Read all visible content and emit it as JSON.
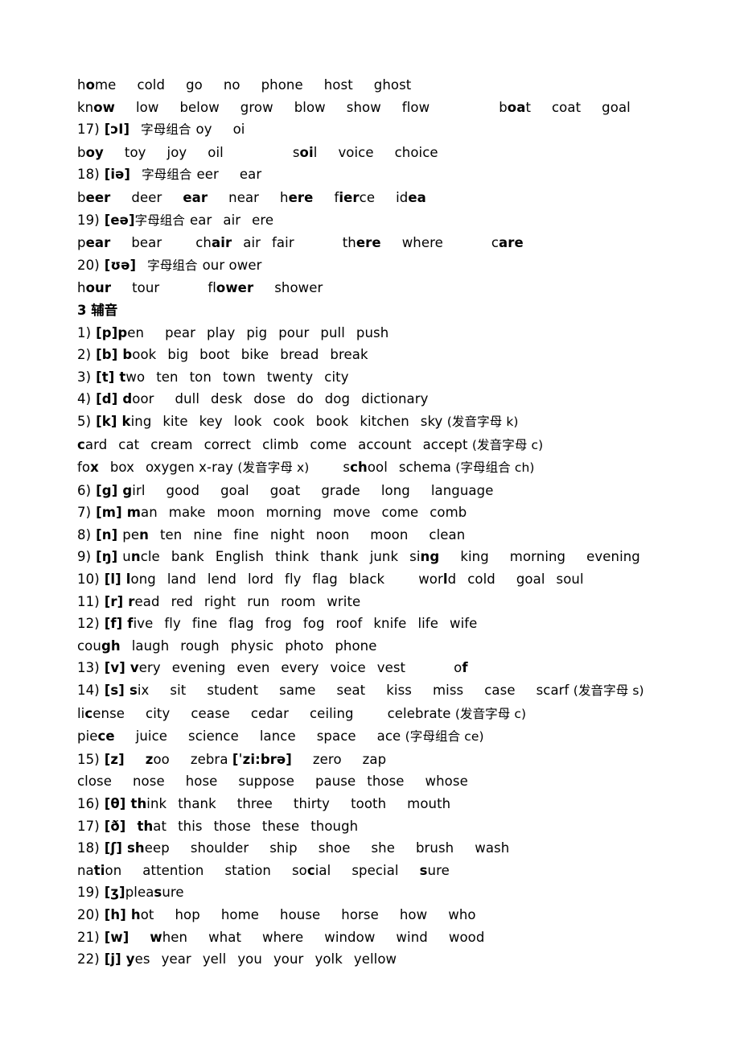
{
  "document": {
    "title_section": "3 辅音",
    "page_language": "zh-CN/en",
    "vowel_lines": [
      {
        "id": "vowel-words-ou-1",
        "words": "home   cold   go   no   phone   host   ghost",
        "text": "home cold go no phone host ghost"
      },
      {
        "id": "vowel-words-ou-2",
        "text": "know low below grow blow show flow boat coat goal"
      },
      {
        "id": "entry-17-header",
        "number": "17)",
        "ipa": "[ɔI]",
        "note": "字母组合",
        "combos": "oy    oi"
      },
      {
        "id": "entry-17-words",
        "text": "boy toy joy oil soil voice choice"
      },
      {
        "id": "entry-18-header",
        "number": "18)",
        "ipa": "[iə]",
        "note": "字母组合",
        "combos": "eer    ear"
      },
      {
        "id": "entry-18-words",
        "text": "beer deer ear near here fierce idea"
      },
      {
        "id": "entry-19-header",
        "number": "19)",
        "ipa": "[eə]",
        "note": "字母组合",
        "combos": "ear  air  ere"
      },
      {
        "id": "entry-19-words",
        "text": "pear bear chair air fair there where care"
      },
      {
        "id": "entry-20-header",
        "number": "20)",
        "ipa": "[ʊə]",
        "note": "字母组合",
        "combos": "our ower"
      },
      {
        "id": "entry-20-words",
        "text": "hour tour flower shower"
      }
    ],
    "section_heading": "3 辅音",
    "consonant_entries": [
      {
        "number": "1)",
        "ipa": "[p]",
        "words": "pen   pear   play   pig   pour   pull   push"
      },
      {
        "number": "2)",
        "ipa": "[b]",
        "words": "book  big  boot  bike  bread  break"
      },
      {
        "number": "3)",
        "ipa": "[t]",
        "words": "two  ten  ton  town  twenty   city"
      },
      {
        "number": "4)",
        "ipa": "[d]",
        "words": "door   dull   desk  dose  do  dog   dictionary"
      },
      {
        "number": "5)",
        "ipa": "[k]",
        "words": "king  kite  key  look  cook  book  kitchen  sky (发音字母 k)"
      },
      {
        "number": "6)",
        "ipa": "[g]",
        "words": "girl   good   goal   goat   grade   long   language"
      },
      {
        "number": "7)",
        "ipa": "[m]",
        "words": "man  make  moon  morning  move  come  comb"
      },
      {
        "number": "8)",
        "ipa": "[n]",
        "words": "pen  ten  nine  fine  night  noon   moon   clean"
      },
      {
        "number": "9)",
        "ipa": "[ŋ]",
        "words": "uncle  bank  English  think  thank  junk  sing   king   morning   evening"
      },
      {
        "number": "10)",
        "ipa": "[l]",
        "words": "long  land  lend  lord  fly  flag  black    world  cold   goal  soul"
      },
      {
        "number": "11)",
        "ipa": "[r]",
        "words": "read  red  right  run  room  write"
      },
      {
        "number": "12)",
        "ipa": "[f]",
        "words": "five  fly  fine  flag  frog  fog  roof  knife  life  wife"
      },
      {
        "number": "13)",
        "ipa": "[v]",
        "words": "very  evening  even  every  voice  vest      of"
      },
      {
        "number": "14)",
        "ipa": "[s]",
        "words": "six   sit   student   same   seat   kiss   miss   case   scarf (发音字母 s)"
      },
      {
        "number": "15)",
        "ipa": "[z]",
        "words": "zoo   zebra [ˈzi:brə]   zero   zap"
      },
      {
        "number": "16)",
        "ipa": "[θ]",
        "words": "think  thank  three  thirty  tooth  mouth"
      },
      {
        "number": "17)",
        "ipa": "[ð]",
        "words": "that  this  those  these  though"
      },
      {
        "number": "18)",
        "ipa": "[ʃ]",
        "words": "sheep   shoulder   ship   shoe   she   brush   wash"
      },
      {
        "number": "19)",
        "ipa": "[ʒ]",
        "words": "pleasure"
      },
      {
        "number": "20)",
        "ipa": "[h]",
        "words": "hot   hop   home   house   horse   how   who"
      },
      {
        "number": "21)",
        "ipa": "[w]",
        "words": "when   what   where   window   wind   wood"
      },
      {
        "number": "22)",
        "ipa": "[j]",
        "words": "yes  year  yell  you  your  yolk  yellow"
      }
    ],
    "continuation_lines": {
      "k_line_2": "card  cat  cream  correct  climb  come  account  accept (发音字母 c)",
      "k_line_3": "fox  box  oxygen x-ray (发音字母 x)      school  schema (字母组合 ch)",
      "f_line_2": "cough  laugh  rough  physic  photo  phone",
      "s_line_2": "license  city  cease  cedar  ceiling   celebrate (发音字母 c)",
      "s_line_3": "piece  juice  science  lance  space   ace (字母组合 ce)",
      "z_line_2": "close  nose  hose  suppose  pause  those  whose",
      "sh_line_2": "nation  attention  station   social  special   sure"
    },
    "annotations": {
      "letter_combo": "字母组合",
      "pronounced_letter": "发音字母",
      "consonant_label": "辅音"
    }
  }
}
